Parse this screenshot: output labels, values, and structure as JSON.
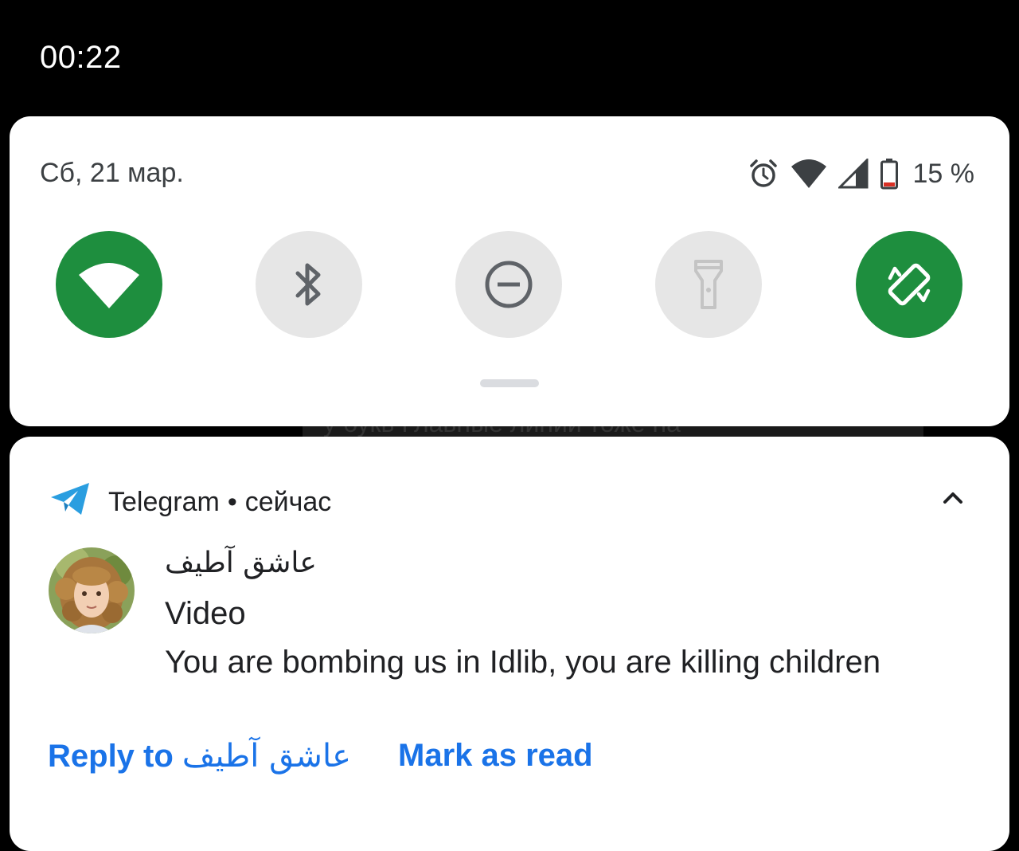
{
  "status_bar": {
    "time": "00:22"
  },
  "quick_settings": {
    "date": "Сб, 21 мар.",
    "battery_text": "15 %",
    "status_icons": [
      "alarm-icon",
      "wifi-signal-icon",
      "cellular-signal-icon",
      "battery-icon"
    ],
    "tiles": [
      {
        "id": "wifi",
        "icon": "wifi-icon",
        "state": "on"
      },
      {
        "id": "bluetooth",
        "icon": "bluetooth-icon",
        "state": "off"
      },
      {
        "id": "do-not-disturb",
        "icon": "do-not-disturb-icon",
        "state": "off"
      },
      {
        "id": "flashlight",
        "icon": "flashlight-icon",
        "state": "unavailable"
      },
      {
        "id": "auto-rotate",
        "icon": "auto-rotate-icon",
        "state": "on"
      }
    ],
    "colors": {
      "tile_on": "#1e8e3e",
      "tile_off": "#e6e6e6",
      "battery_low": "#d93025"
    }
  },
  "background_peek_text": "у букв Главные линии тоже на",
  "notification": {
    "app_name": "Telegram",
    "separator": "•",
    "time": "сейчас",
    "sender": "عاشق آطيف",
    "title": "Video",
    "body": "You are bombing us in Idlib, you are killing children",
    "actions": {
      "reply_label": "Reply to",
      "reply_target": "عاشق آطيف",
      "mark_read_label": "Mark as read"
    },
    "colors": {
      "app_icon": "#2a9ee0",
      "action_text": "#1a73e8"
    }
  }
}
